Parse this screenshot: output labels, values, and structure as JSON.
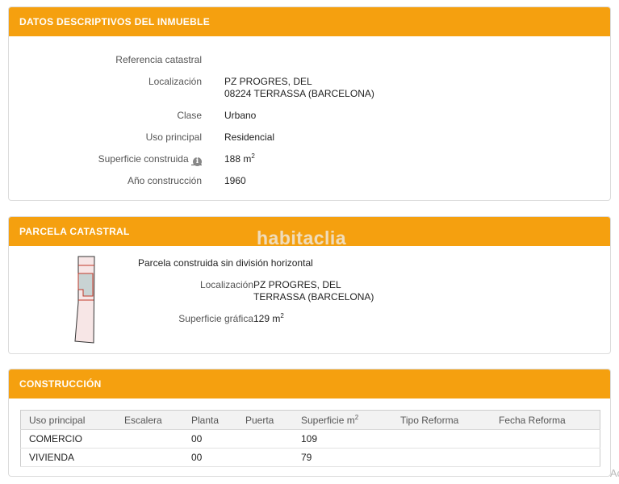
{
  "descriptive": {
    "header": "DATOS DESCRIPTIVOS DEL INMUEBLE",
    "rows": [
      {
        "label": "Referencia catastral",
        "value": ""
      },
      {
        "label": "Localización",
        "value_line1": "PZ PROGRES, DEL",
        "value_line2": "08224 TERRASSA (BARCELONA)"
      },
      {
        "label": "Clase",
        "value": "Urbano"
      },
      {
        "label": "Uso principal",
        "value": "Residencial"
      },
      {
        "label": "Superficie construida",
        "value": "188 m",
        "unit_sup": "2"
      },
      {
        "label": "Año construcción",
        "value": "1960"
      }
    ]
  },
  "parcel": {
    "header": "PARCELA CATASTRAL",
    "subtitle": "Parcela construida sin división horizontal",
    "location_label": "Localización",
    "location_line1": "PZ PROGRES, DEL",
    "location_line2": "TERRASSA (BARCELONA)",
    "surface_label": "Superficie gráfica",
    "surface_value": "129 m",
    "surface_sup": "2"
  },
  "construction": {
    "header": "CONSTRUCCIÓN",
    "columns": [
      "Uso principal",
      "Escalera",
      "Planta",
      "Puerta",
      "Superficie m",
      "Tipo Reforma",
      "Fecha Reforma"
    ],
    "surface_sup": "2",
    "rows": [
      [
        "COMERCIO",
        "",
        "00",
        "",
        "109",
        "",
        ""
      ],
      [
        "VIVIENDA",
        "",
        "00",
        "",
        "79",
        "",
        ""
      ]
    ]
  },
  "watermark": "habitaclia",
  "edge_text": "Ac",
  "colors": {
    "header_bg": "#f5a00f",
    "header_text": "#ffffff"
  }
}
